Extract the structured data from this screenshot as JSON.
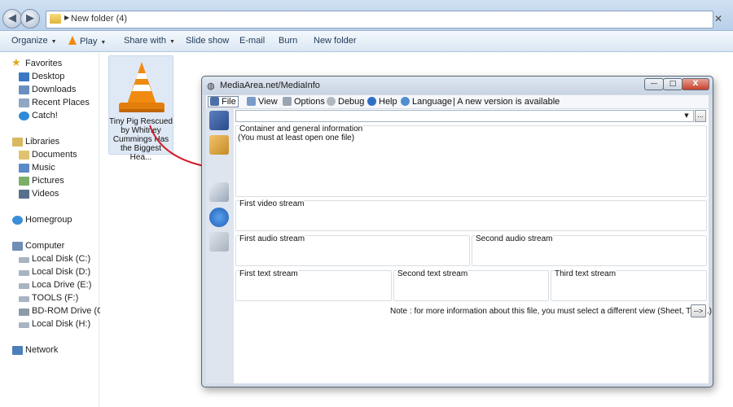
{
  "explorer": {
    "address": "New folder (4)",
    "toolbar": [
      "Organize",
      "Play",
      "Share with",
      "Slide show",
      "E-mail",
      "Burn",
      "New folder"
    ],
    "nav": {
      "favorites_header": "Favorites",
      "favorites": [
        "Desktop",
        "Downloads",
        "Recent Places",
        "Catch!"
      ],
      "libraries_header": "Libraries",
      "libraries": [
        "Documents",
        "Music",
        "Pictures",
        "Videos"
      ],
      "homegroup": "Homegroup",
      "computer_header": "Computer",
      "drives": [
        "Local Disk (C:)",
        "Local Disk (D:)",
        "Loca Drive (E:)",
        "TOOLS (F:)",
        "BD-ROM Drive (G:) J",
        "Local Disk (H:)"
      ],
      "network": "Network"
    },
    "file": {
      "name_lines": [
        "Tiny Pig Rescued",
        "by Whitney",
        "Cummings Has",
        "the Biggest Hea..."
      ]
    }
  },
  "mediainfo": {
    "title": "MediaArea.net/MediaInfo",
    "window_buttons": {
      "min": "—",
      "max": "□",
      "close": "X"
    },
    "menu": {
      "file": "File",
      "view": "View",
      "options": "Options",
      "debug": "Debug",
      "help": "Help",
      "language": "Language",
      "notice": "| A new version is available"
    },
    "browse_label": "...",
    "groups": {
      "general_title": "Container and general information",
      "general_text": "(You must at least open one file)",
      "video1": "First video stream",
      "audio1": "First audio stream",
      "audio2": "Second audio stream",
      "text1": "First text stream",
      "text2": "Second text stream",
      "text3": "Third text stream"
    },
    "note": "Note : for more information about this file, you must select a different view (Sheet, Tree...)",
    "go_label": "-->"
  },
  "colors": {
    "accent": "#3a6ea5",
    "vlc_orange": "#f08a10",
    "arrow_red": "#d0202a"
  }
}
